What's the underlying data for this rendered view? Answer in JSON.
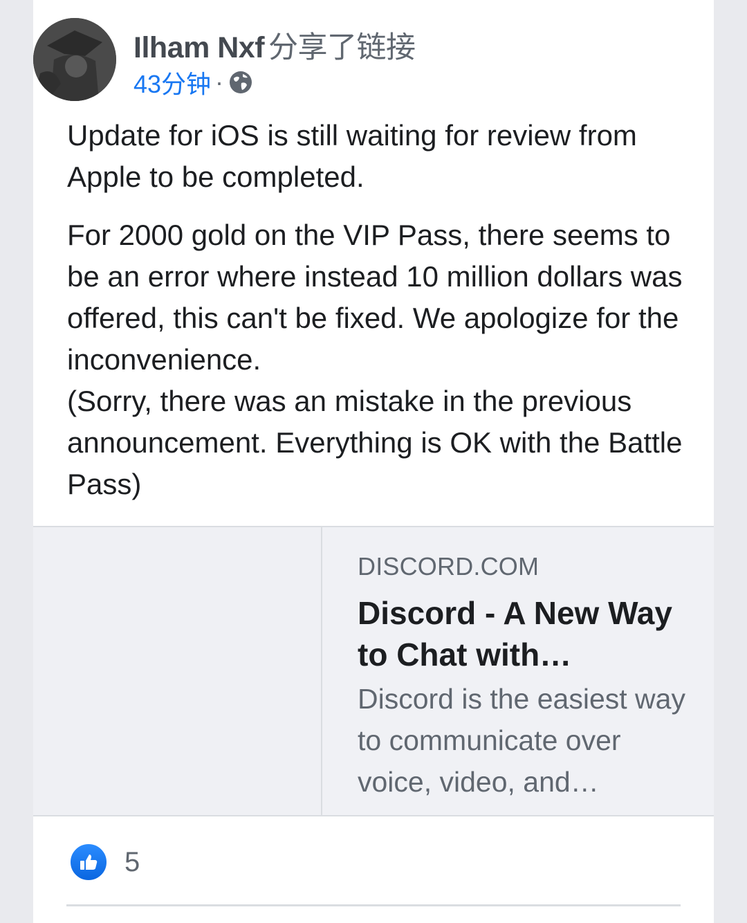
{
  "post": {
    "author": "Ilham Nxf",
    "action": "分享了链接",
    "time": "43分钟",
    "separator": "·",
    "privacy_icon": "globe-icon",
    "text_para1": "Update for iOS is still waiting for review from Apple to be completed.",
    "text_para2_line1": "For 2000 gold on the VIP Pass, there seems to be an error where instead 10 million dollars was offered, this can't be fixed. We apologize for the inconvenience.",
    "text_para2_line2": "(Sorry, there was an mistake in the previous announcement. Everything is OK with the Battle Pass)"
  },
  "link_preview": {
    "domain": "DISCORD.COM",
    "title": "Discord - A New Way to Chat with…",
    "description": "Discord is the easiest way to communicate over voice, video, and…"
  },
  "reactions": {
    "icon": "like-icon",
    "count": "5"
  },
  "colors": {
    "link_blue": "#1877f2",
    "like_blue": "#1877f2",
    "text": "#1c1e21",
    "secondary": "#606770"
  }
}
